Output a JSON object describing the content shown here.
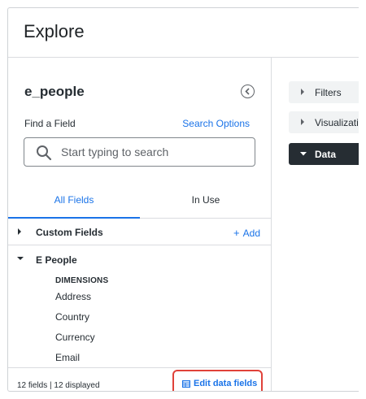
{
  "app": {
    "title": "Explore"
  },
  "field_picker": {
    "model_name": "e_people",
    "find_label": "Find a Field",
    "search_options": "Search Options",
    "search_placeholder": "Start typing to search",
    "search_value": "",
    "tabs": [
      {
        "label": "All Fields",
        "active": true
      },
      {
        "label": "In Use",
        "active": false
      }
    ],
    "custom_fields": {
      "label": "Custom Fields",
      "add_label": "Add"
    },
    "view_group": {
      "label": "E People",
      "expanded": true,
      "dimensions_header": "DIMENSIONS",
      "dimensions": [
        "Address",
        "Country",
        "Currency",
        "Email"
      ]
    },
    "footer": {
      "field_count": "12 fields | 12 displayed",
      "edit_label": "Edit data fields"
    }
  },
  "side_sections": [
    {
      "label": "Filters",
      "expanded": false
    },
    {
      "label": "Visualization",
      "expanded": false
    },
    {
      "label": "Data",
      "expanded": true
    }
  ],
  "colors": {
    "accent": "#1a73e8",
    "highlight": "#e0423a",
    "dark": "#262d33"
  }
}
